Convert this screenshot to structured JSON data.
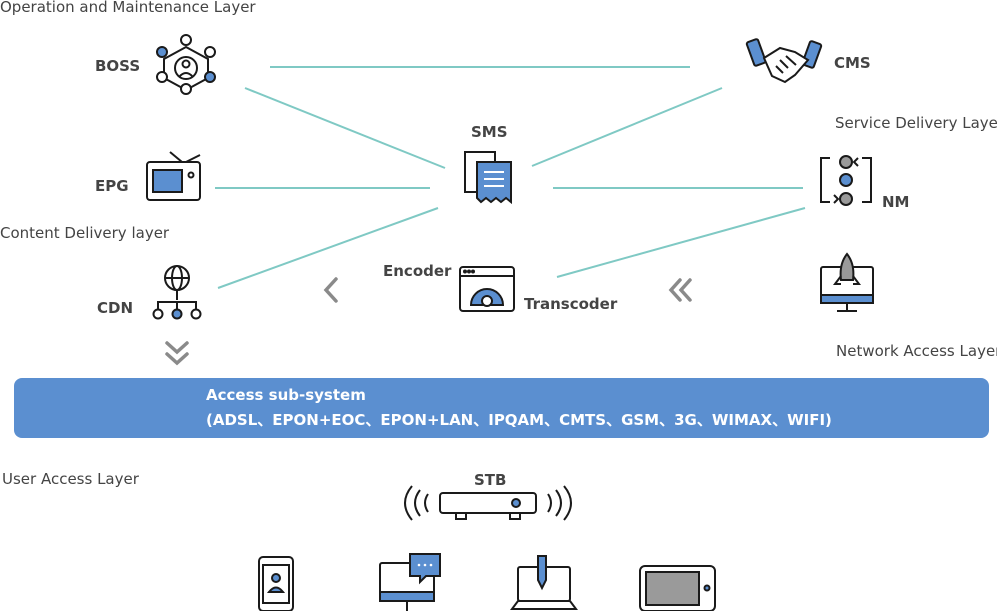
{
  "layers": {
    "operation_maintenance": "Operation and Maintenance Layer",
    "service_delivery": "Service Delivery Layer",
    "content_delivery": "Content Delivery layer",
    "network_access": "Network  Access Layer",
    "user_access": "User Access Layer"
  },
  "nodes": {
    "boss": "BOSS",
    "cms": "CMS",
    "sms": "SMS",
    "epg": "EPG",
    "nm": "NM",
    "cdn": "CDN",
    "encoder": "Encoder",
    "transcoder": "Transcoder",
    "stb": "STB"
  },
  "access_subsystem": {
    "title": "Access sub-system",
    "detail": "(ADSL、EPON+EOC、EPON+LAN、IPQAM、CMTS、GSM、3G、WIMAX、WIFI)"
  },
  "colors": {
    "connector": "#7fc9c4",
    "accent_blue": "#5b8fd0",
    "icon_stroke": "#1a1a1a",
    "icon_gray": "#9a9a9a",
    "arrow_gray": "#8a8a8a"
  },
  "icons": [
    "network-people-icon",
    "handshake-icon",
    "document-server-icon",
    "tv-icon",
    "switch-toggle-icon",
    "globe-network-icon",
    "gear-window-icon",
    "rocket-monitor-icon",
    "stb-wireless-icon",
    "mobile-phone-icon",
    "desktop-chat-icon",
    "laptop-pen-icon",
    "tablet-icon"
  ]
}
